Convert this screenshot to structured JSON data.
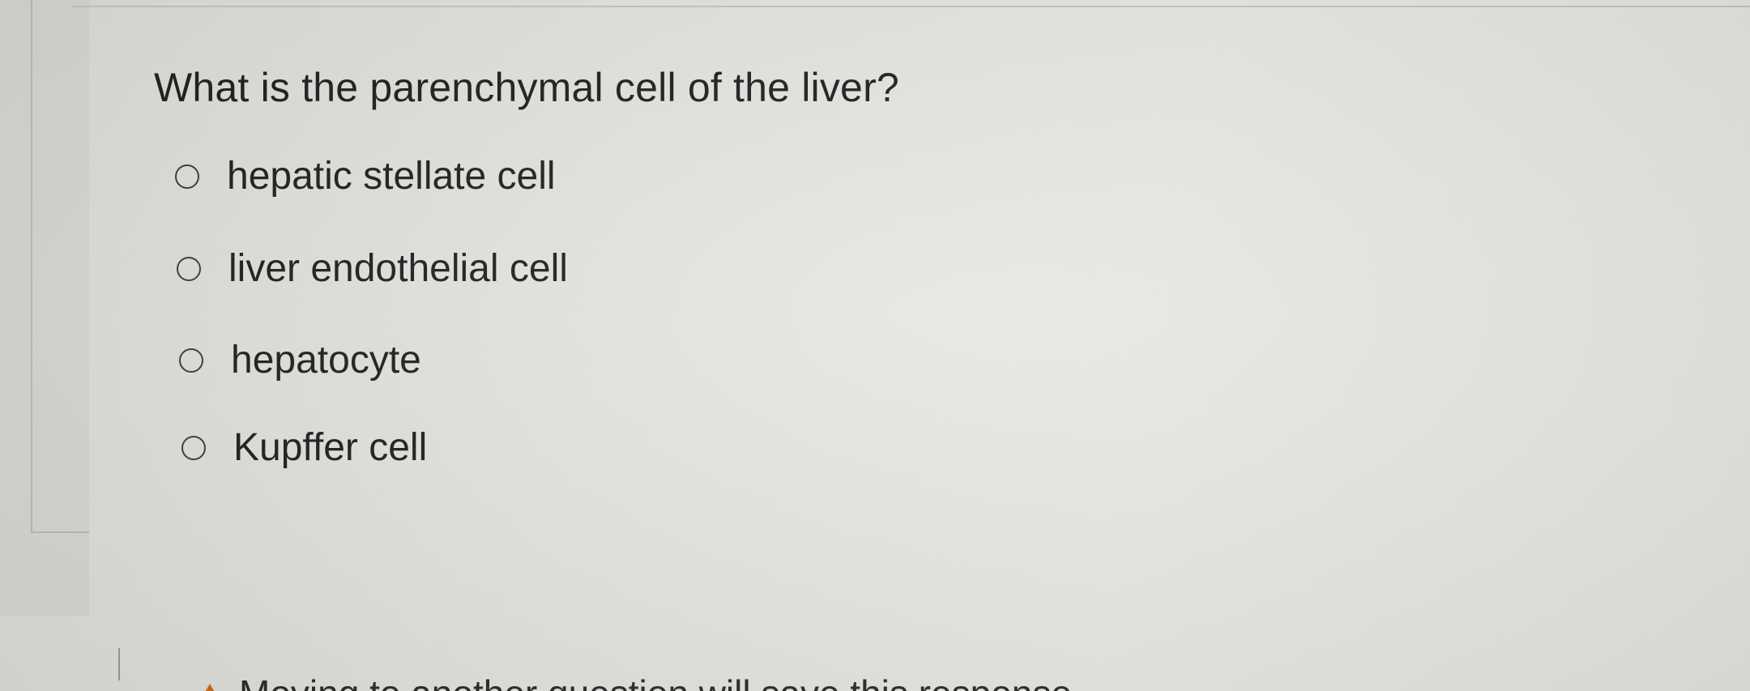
{
  "question": {
    "text": "What is the parenchymal cell of the liver?"
  },
  "options": [
    {
      "label": "hepatic stellate cell",
      "selected": false
    },
    {
      "label": "liver endothelial cell",
      "selected": false
    },
    {
      "label": "hepatocyte",
      "selected": false
    },
    {
      "label": "Kupffer cell",
      "selected": false
    }
  ],
  "footer": {
    "warning_icon": "warning-icon",
    "warning_text": "Moving to another question will save this response."
  },
  "colors": {
    "background": "#e3e3df",
    "text": "#1c1c1c",
    "warning": "#c96a1e"
  }
}
